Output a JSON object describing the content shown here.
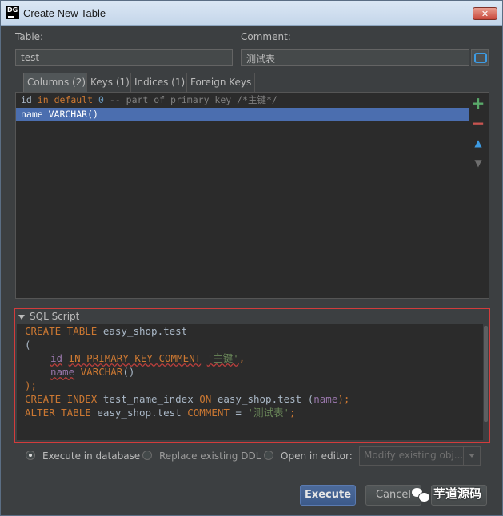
{
  "window": {
    "title": "Create New Table",
    "app_icon_text": "DG",
    "close_label": "✕"
  },
  "form": {
    "table_label": "Table:",
    "table_value": "test",
    "comment_label": "Comment:",
    "comment_value": "测试表"
  },
  "tabs": [
    {
      "label": "Columns (2)",
      "active": true
    },
    {
      "label": "Keys (1)",
      "active": false
    },
    {
      "label": "Indices (1)",
      "active": false
    },
    {
      "label": "Foreign Keys",
      "active": false
    }
  ],
  "columns": [
    {
      "name": "id",
      "in": "in",
      "default_kw": "default",
      "default_val": "0",
      "comment": "-- part of primary key /*主键*/",
      "selected": false
    },
    {
      "text": "name VARCHAR()",
      "selected": true
    }
  ],
  "tools": {
    "add": "+",
    "remove": "−",
    "up": "▲",
    "down": "▼"
  },
  "sql_script": {
    "header": "SQL Script",
    "lines": {
      "l1_kw": "CREATE TABLE",
      "l1_rest": " easy_shop.test",
      "l2": "(",
      "l3_col": "id",
      "l3_kw": "IN PRIMARY KEY COMMENT",
      "l3_str": "'主键'",
      "l3_end": ",",
      "l4_col": "name",
      "l4_type": "VARCHAR",
      "l4_end": "()",
      "l5": ");",
      "l6_kw1": "CREATE INDEX",
      "l6_mid1": " test_name_index ",
      "l6_kw2": "ON",
      "l6_mid2": " easy_shop.test (",
      "l6_fld": "name",
      "l6_end": ");",
      "l7_kw": "ALTER TABLE",
      "l7_mid": " easy_shop.test ",
      "l7_kw2": "COMMENT",
      "l7_eq": " = ",
      "l7_str": "'测试表'",
      "l7_end": ";"
    }
  },
  "options": {
    "execute_in_db": "Execute in database",
    "replace_ddl": "Replace existing DDL",
    "open_in_editor": "Open in editor:",
    "editor_combo": "Modify existing obj...",
    "selected": "execute_in_db"
  },
  "buttons": {
    "execute": "Execute",
    "cancel": "Cancel"
  },
  "watermark": {
    "text": "芋道源码"
  },
  "colors": {
    "accent": "#4b6eaf",
    "highlight_border": "#d23c3c",
    "add": "#59a869",
    "remove": "#c75450",
    "move": "#3d9be3"
  }
}
